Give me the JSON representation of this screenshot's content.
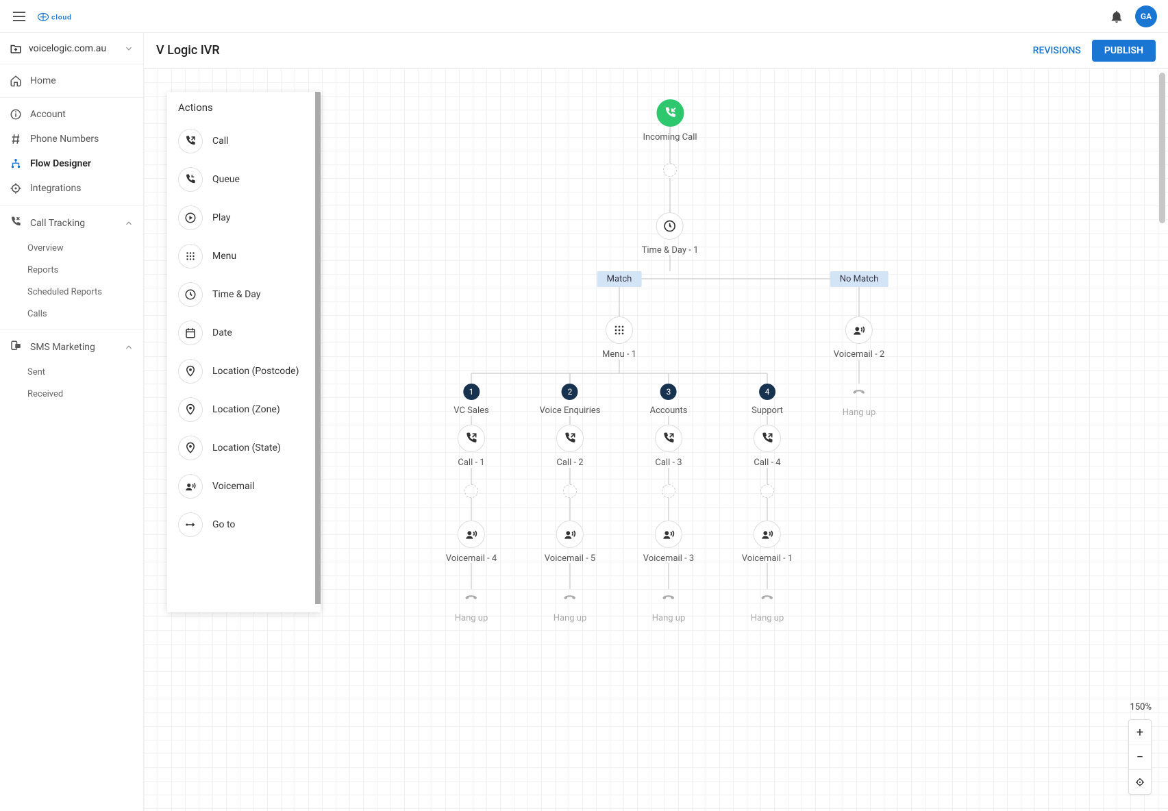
{
  "topbar": {
    "logo_text": "cloud",
    "avatar_initials": "GA"
  },
  "sidebar": {
    "domain": "voicelogic.com.au",
    "items": [
      {
        "label": "Home"
      },
      {
        "label": "Account"
      },
      {
        "label": "Phone Numbers"
      },
      {
        "label": "Flow Designer"
      },
      {
        "label": "Integrations"
      }
    ],
    "groups": [
      {
        "label": "Call Tracking",
        "items": [
          "Overview",
          "Reports",
          "Scheduled Reports",
          "Calls"
        ]
      },
      {
        "label": "SMS Marketing",
        "items": [
          "Sent",
          "Received"
        ]
      }
    ]
  },
  "main": {
    "title": "V Logic IVR",
    "revisions_label": "REVISIONS",
    "publish_label": "PUBLISH"
  },
  "actions_panel": {
    "title": "Actions",
    "items": [
      "Call",
      "Queue",
      "Play",
      "Menu",
      "Time & Day",
      "Date",
      "Location (Postcode)",
      "Location (Zone)",
      "Location (State)",
      "Voicemail",
      "Go to"
    ]
  },
  "zoom": {
    "label": "150%"
  },
  "flow": {
    "incoming": "Incoming Call",
    "timeday": "Time & Day - 1",
    "match": "Match",
    "nomatch": "No Match",
    "menu": "Menu - 1",
    "voicemail2": "Voicemail - 2",
    "hangup": "Hang up",
    "branches": [
      {
        "num": "1",
        "name": "VC Sales",
        "call": "Call - 1",
        "vm": "Voicemail - 4"
      },
      {
        "num": "2",
        "name": "Voice Enquiries",
        "call": "Call - 2",
        "vm": "Voicemail - 5"
      },
      {
        "num": "3",
        "name": "Accounts",
        "call": "Call - 3",
        "vm": "Voicemail - 3"
      },
      {
        "num": "4",
        "name": "Support",
        "call": "Call - 4",
        "vm": "Voicemail - 1"
      }
    ]
  }
}
